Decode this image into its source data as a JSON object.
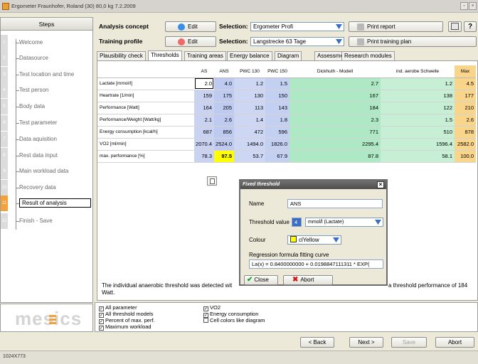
{
  "window": {
    "title": "Ergometer Fraunhofer, Roland (30) 80,0 kg 7.2.2009"
  },
  "sidebar": {
    "heading": "Steps",
    "steps": [
      {
        "num": "1",
        "label": "Welcome"
      },
      {
        "num": "2",
        "label": "Datasource"
      },
      {
        "num": "3",
        "label": "Test location and time"
      },
      {
        "num": "4",
        "label": "Test person"
      },
      {
        "num": "5",
        "label": "Body data"
      },
      {
        "num": "6",
        "label": "Test parameter"
      },
      {
        "num": "7",
        "label": "Data aquisition"
      },
      {
        "num": "8",
        "label": "Rest data input"
      },
      {
        "num": "9",
        "label": "Main workload data"
      },
      {
        "num": "10",
        "label": "Recovery data"
      },
      {
        "num": "11",
        "label": "Result of analysis"
      },
      {
        "num": "12",
        "label": "Finish - Save"
      }
    ],
    "active_step": "11",
    "logo": "mesics"
  },
  "header": {
    "analysis_label": "Analysis concept",
    "training_label": "Training profile",
    "edit_label": "Edit",
    "selection_label": "Selection:",
    "analysis_selection": "Ergometer Profi",
    "training_selection": "Langstrecke 63 Tage",
    "print_report": "Print report",
    "print_training": "Print training plan",
    "help": "?"
  },
  "tabs": [
    {
      "label": "Plausibility check",
      "active": false
    },
    {
      "label": "Thresholds",
      "active": true
    },
    {
      "label": "Training areas",
      "active": false
    },
    {
      "label": "Energy balance",
      "active": false
    },
    {
      "label": "Diagram",
      "active": false
    },
    {
      "label": "Assessment",
      "active": false
    },
    {
      "label": "Research modules",
      "active": false
    }
  ],
  "table": {
    "columns": [
      "AS",
      "ANS",
      "PWC 130",
      "PWC 150",
      "Dickhuth - Modell",
      "ind. aerobe Schwelle",
      "Max"
    ],
    "rows": [
      {
        "label": "Lactate [mmol/l]",
        "values": [
          "2.0",
          "4.0",
          "1.2",
          "1.5",
          "2.7",
          "1.2",
          "4.5"
        ]
      },
      {
        "label": "Heartrate [1/min]",
        "values": [
          "159",
          "175",
          "130",
          "150",
          "167",
          "138",
          "177"
        ]
      },
      {
        "label": "Performance [Watt]",
        "values": [
          "164",
          "205",
          "113",
          "143",
          "184",
          "122",
          "210"
        ]
      },
      {
        "label": "Performance/Weight [Watt/kg]",
        "values": [
          "2.1",
          "2.6",
          "1.4",
          "1.8",
          "2.3",
          "1.5",
          "2.6"
        ]
      },
      {
        "label": "Energy consumption [kcal/h]",
        "values": [
          "687",
          "856",
          "472",
          "596",
          "771",
          "510",
          "878"
        ]
      },
      {
        "label": "VO2 [ml/min]",
        "values": [
          "2070.4",
          "2524.0",
          "1494.0",
          "1826.0",
          "2295.4",
          "1596.4",
          "2582.0"
        ]
      },
      {
        "label": "max. performance [%]",
        "values": [
          "78.3",
          "97.5",
          "53.7",
          "67.9",
          "87.8",
          "58.1",
          "100.0"
        ]
      }
    ]
  },
  "info_text": {
    "left": "The individual anaerobic threshold was detected wit",
    "right": "a threshold performance of 184",
    "line2": "Watt."
  },
  "checkboxes": [
    {
      "label": "All parameter",
      "checked": true
    },
    {
      "label": "All threshold models",
      "checked": true
    },
    {
      "label": "Percent of max. perf.",
      "checked": true
    },
    {
      "label": "Maximum workload",
      "checked": true
    },
    {
      "label": "VO2",
      "checked": true
    },
    {
      "label": "Energy consumption",
      "checked": true
    },
    {
      "label": "Cell colors like diagram",
      "checked": false
    }
  ],
  "dialog": {
    "title": "Fixed threshold",
    "name_label": "Name",
    "name_value": "ANS",
    "threshold_label": "Threshold value",
    "threshold_value": "4",
    "unit": "mmol/l (Lactate)",
    "colour_label": "Colour",
    "colour_value": "clYellow",
    "colour_swatch": "#ffff00",
    "regression_label": "Regression formula fitting curve",
    "regression_value": "La(x) = 0.8400000000 + 0.0198847111311 * EXP(",
    "close_label": "Close",
    "abort_label": "Abort"
  },
  "footer": {
    "back": "< Back",
    "next": "Next >",
    "save": "Save",
    "abort": "Abort"
  },
  "status": {
    "resolution": "1024X773"
  },
  "colors": {
    "accent_orange": "#f3a23b",
    "col_as": "#c9d2f0",
    "col_dickhuth": "#aee8c4",
    "col_max": "#f8d58a",
    "highlight": "#ffff00"
  }
}
